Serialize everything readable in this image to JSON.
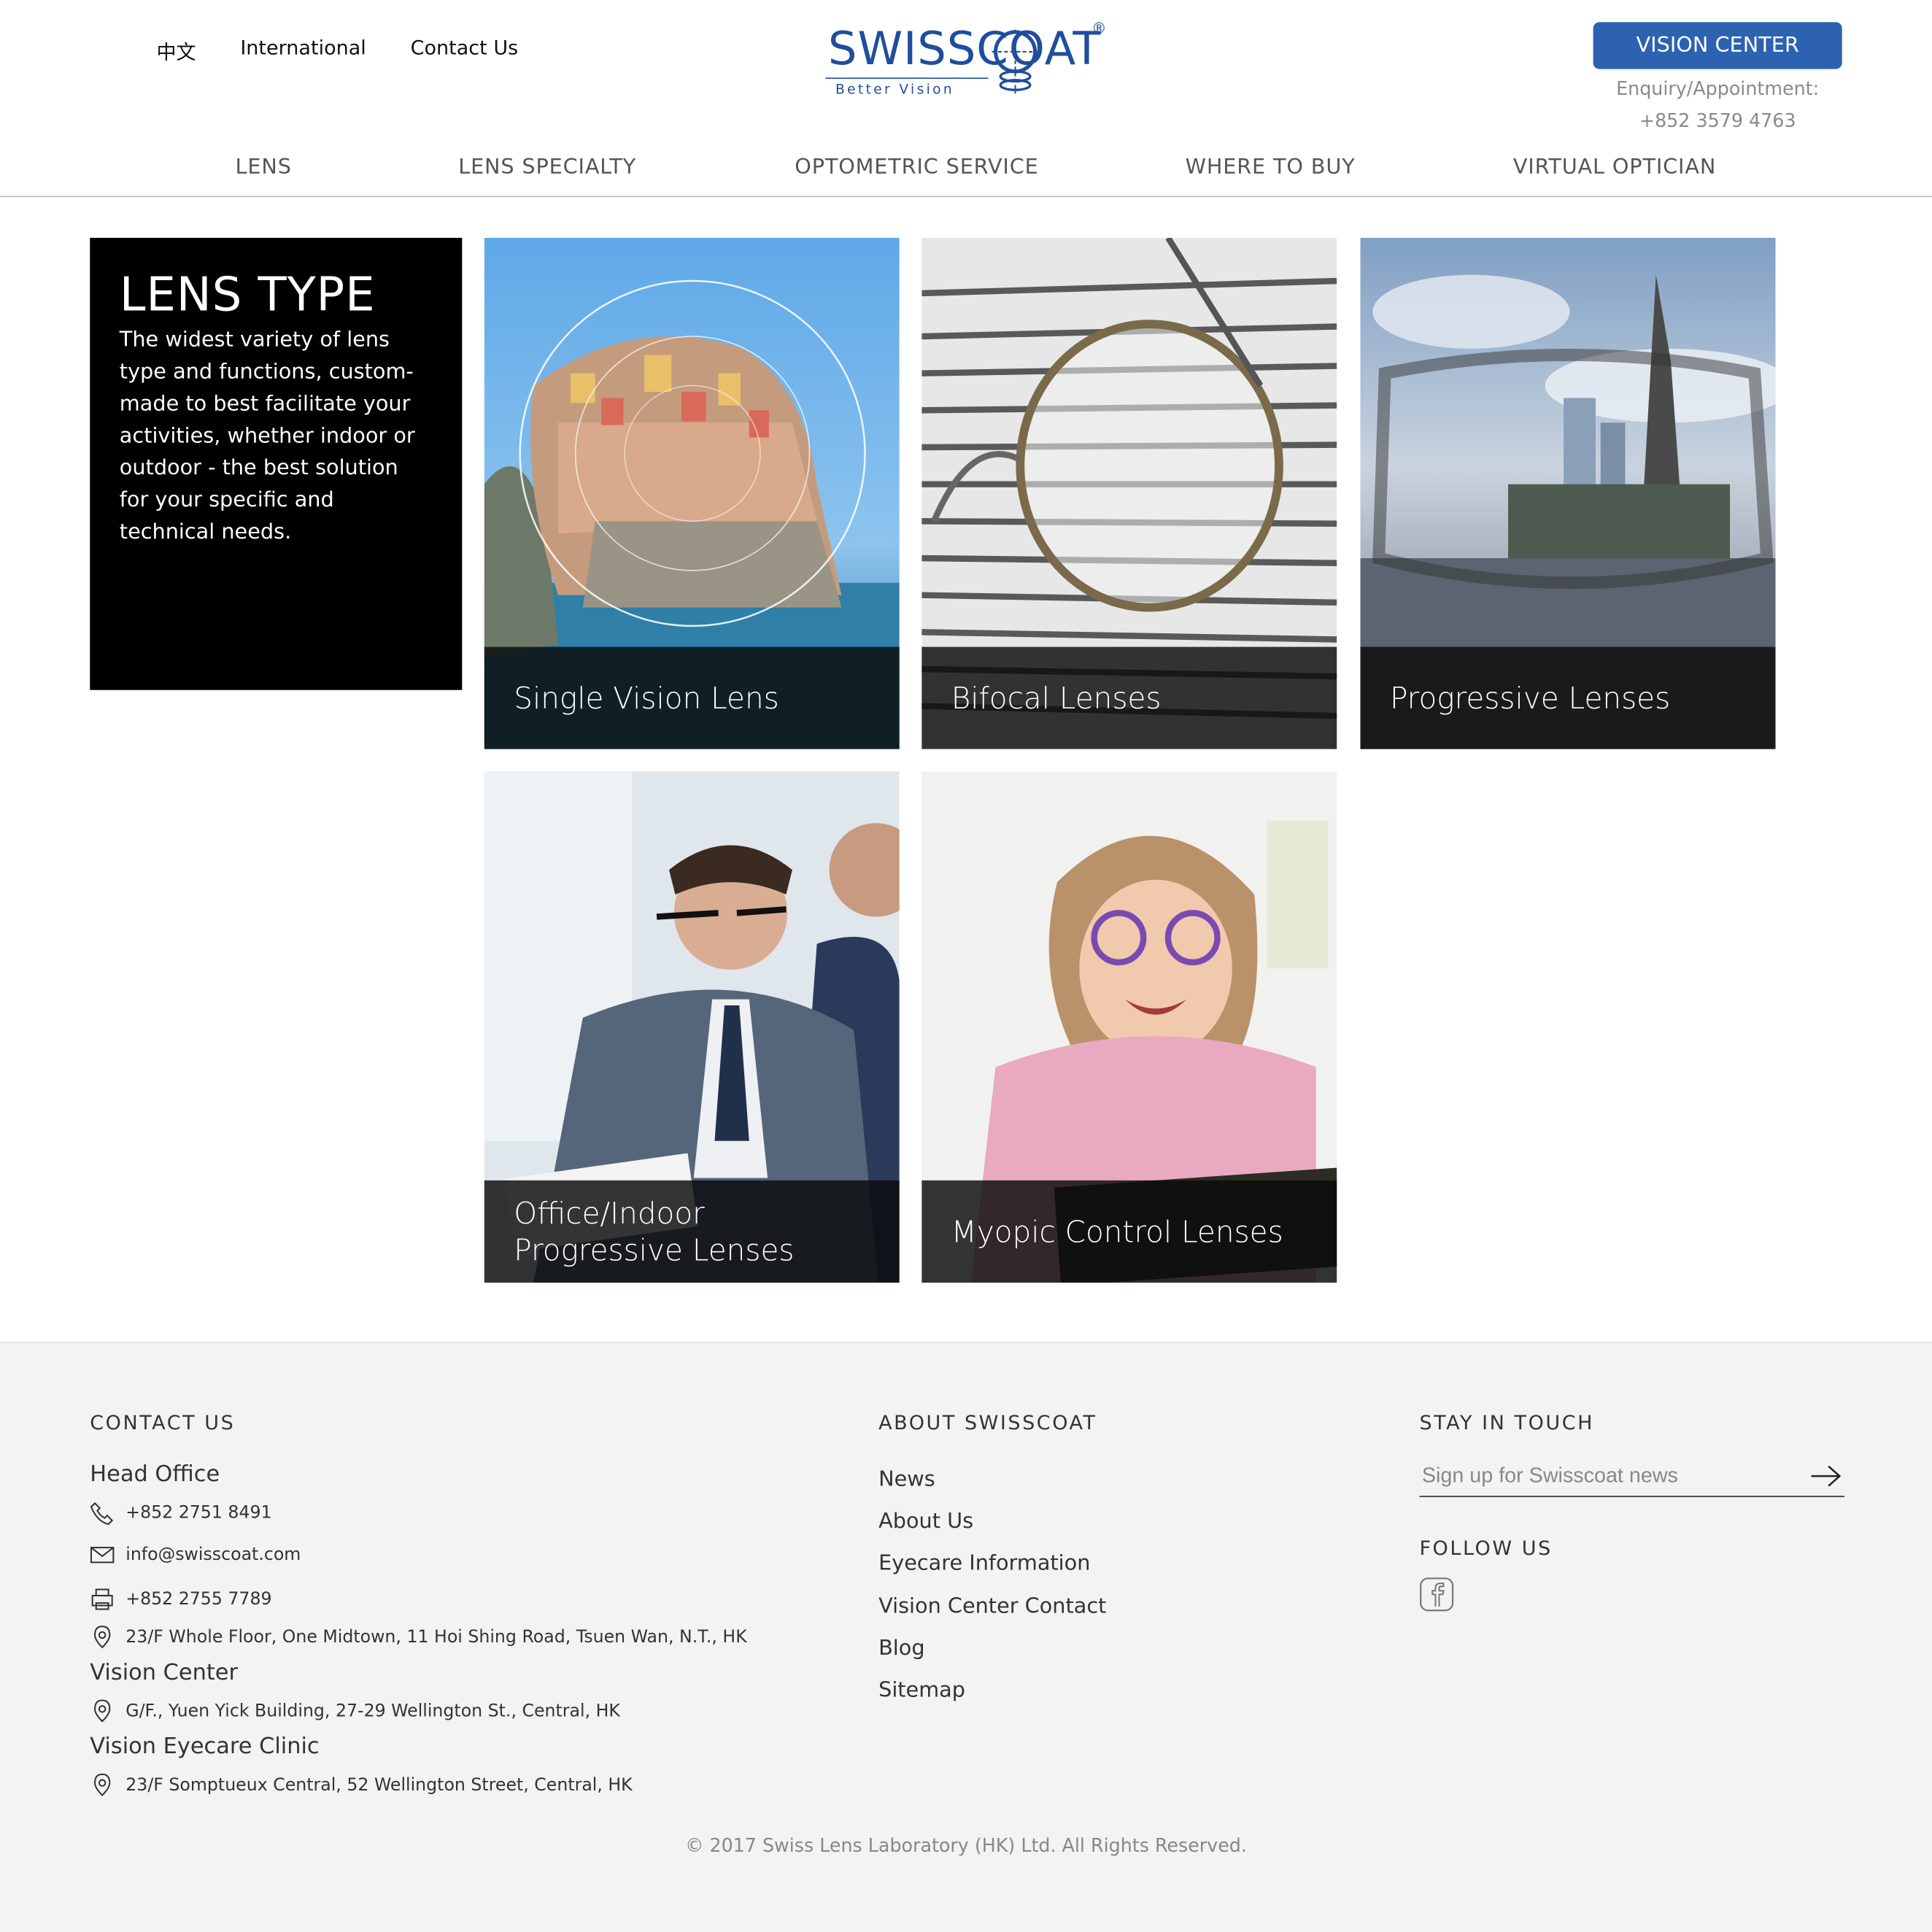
{
  "header": {
    "toplinks": [
      "中文",
      "International",
      "Contact Us"
    ],
    "logo": {
      "word": "SWISSCOAT",
      "tagline": "Better Vision",
      "reg": "®"
    },
    "vision_center_button": "VISION CENTER",
    "enquiry_label": "Enquiry/Appointment:",
    "enquiry_phone": "+852 3579 4763",
    "nav": [
      "LENS",
      "LENS SPECIALTY",
      "OPTOMETRIC SERVICE",
      "WHERE TO BUY",
      "VIRTUAL OPTICIAN"
    ]
  },
  "intro": {
    "title": "LENS TYPE",
    "text": "The widest variety of lens type and functions, custom-made to best facilitate your activities, whether indoor or outdoor - the best solution for your specific and technical needs."
  },
  "tiles": [
    {
      "label": "Single Vision Lens"
    },
    {
      "label": "Bifocal Lenses"
    },
    {
      "label": "Progressive Lenses"
    },
    {
      "label": "Office/Indoor Progressive Lenses"
    },
    {
      "label": "Myopic Control Lenses"
    }
  ],
  "footer": {
    "contact": {
      "heading": "CONTACT US",
      "head_office": "Head Office",
      "phone": "+852 2751 8491",
      "email": "info@swisscoat.com",
      "fax": "+852 2755 7789",
      "address": "23/F Whole Floor, One Midtown, 11 Hoi Shing Road, Tsuen Wan, N.T., HK",
      "vision_center": "Vision Center",
      "vision_center_address": "G/F., Yuen Yick Building, 27-29 Wellington St., Central, HK",
      "clinic": "Vision Eyecare Clinic",
      "clinic_address": "23/F Somptueux Central, 52 Wellington Street, Central, HK"
    },
    "about": {
      "heading": "ABOUT SWISSCOAT",
      "links": [
        "News",
        "About Us",
        "Eyecare Information",
        "Vision Center Contact",
        "Blog",
        "Sitemap"
      ]
    },
    "stay": {
      "heading": "STAY IN TOUCH",
      "signup_placeholder": "Sign up for Swisscoat news",
      "follow_heading": "FOLLOW US"
    },
    "copyright": "© 2017 Swiss Lens Laboratory (HK) Ltd. All Rights Reserved."
  },
  "colors": {
    "brand_blue": "#1f4e9c",
    "button_blue": "#2c62b0",
    "footer_bg": "#f3f3f3"
  },
  "icons": [
    "phone-icon",
    "mail-icon",
    "fax-icon",
    "location-pin-icon",
    "arrow-right-icon",
    "facebook-icon"
  ]
}
